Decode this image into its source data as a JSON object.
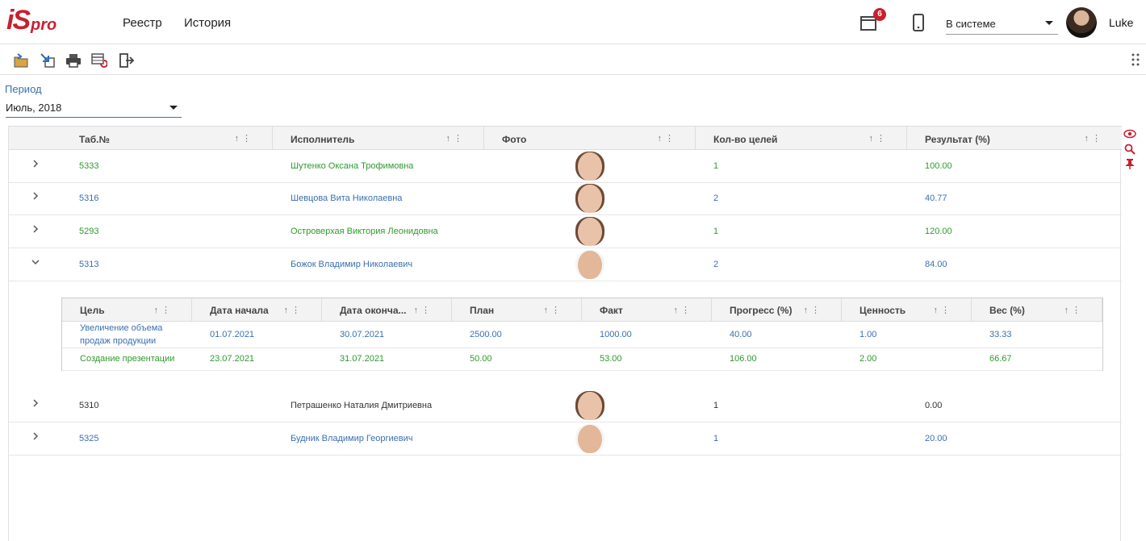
{
  "header": {
    "logo_i": "iS",
    "logo_pro": "pro",
    "nav": [
      "Реестр",
      "История"
    ],
    "calendar_badge": "6",
    "status": "В системе",
    "username": "Luke"
  },
  "toolbar": {
    "buttons": [
      "open-folder-icon",
      "export-icon",
      "print-icon",
      "refresh-table-icon",
      "exit-icon"
    ]
  },
  "filter": {
    "period_label": "Период",
    "period_value": "Июль, 2018"
  },
  "grid": {
    "columns": [
      "Таб.№",
      "Исполнитель",
      "Фото",
      "Кол-во целей",
      "Результат (%)"
    ],
    "rows": [
      {
        "tab": "5333",
        "name": "Шутенко Оксана Трофимовна",
        "goals": "1",
        "result": "100.00",
        "color": "green",
        "expanded": false,
        "photo": "female"
      },
      {
        "tab": "5316",
        "name": "Шевцова Вита Николаевна",
        "goals": "2",
        "result": "40.77",
        "color": "blue",
        "expanded": false,
        "photo": "female"
      },
      {
        "tab": "5293",
        "name": "Островерхая Виктория Леонидовна",
        "goals": "1",
        "result": "120.00",
        "color": "green",
        "expanded": false,
        "photo": "female"
      },
      {
        "tab": "5313",
        "name": "Божок Владимир Николаевич",
        "goals": "2",
        "result": "84.00",
        "color": "blue",
        "expanded": true,
        "photo": "male"
      },
      {
        "tab": "5310",
        "name": "Петрашенко Наталия Дмитриевна",
        "goals": "1",
        "result": "0.00",
        "color": "dark",
        "expanded": false,
        "photo": "female"
      },
      {
        "tab": "5325",
        "name": "Будник Владимир Георгиевич",
        "goals": "1",
        "result": "20.00",
        "color": "blue",
        "expanded": false,
        "photo": "male"
      }
    ]
  },
  "detail": {
    "columns": [
      "Цель",
      "Дата начала",
      "Дата оконча...",
      "План",
      "Факт",
      "Прогресс (%)",
      "Ценность",
      "Вес (%)"
    ],
    "rows": [
      {
        "goal_line1": "Увеличение объема",
        "goal_line2": "продаж продукции",
        "start": "01.07.2021",
        "end": "30.07.2021",
        "plan": "2500.00",
        "fact": "1000.00",
        "progress": "40.00",
        "value": "1.00",
        "weight": "33.33",
        "color": "blue"
      },
      {
        "goal_line1": "Создание презентации",
        "goal_line2": "",
        "start": "23.07.2021",
        "end": "31.07.2021",
        "plan": "50.00",
        "fact": "53.00",
        "progress": "106.00",
        "value": "2.00",
        "weight": "66.67",
        "color": "green"
      }
    ]
  },
  "colors": {
    "accent": "#3a6fb0",
    "green": "#2e9a2e",
    "brand_red": "#c8202e"
  }
}
